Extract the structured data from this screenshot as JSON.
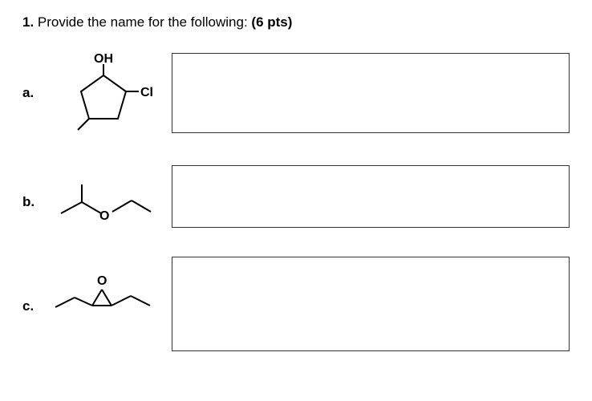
{
  "question": {
    "number": "1.",
    "prompt": "Provide the name for the following:",
    "points": "(6 pts)"
  },
  "items": {
    "a": {
      "label": "a.",
      "atoms": {
        "oh": "OH",
        "cl": "Cl"
      }
    },
    "b": {
      "label": "b.",
      "atoms": {
        "o": "O"
      }
    },
    "c": {
      "label": "c.",
      "atoms": {
        "o": "O"
      }
    }
  }
}
